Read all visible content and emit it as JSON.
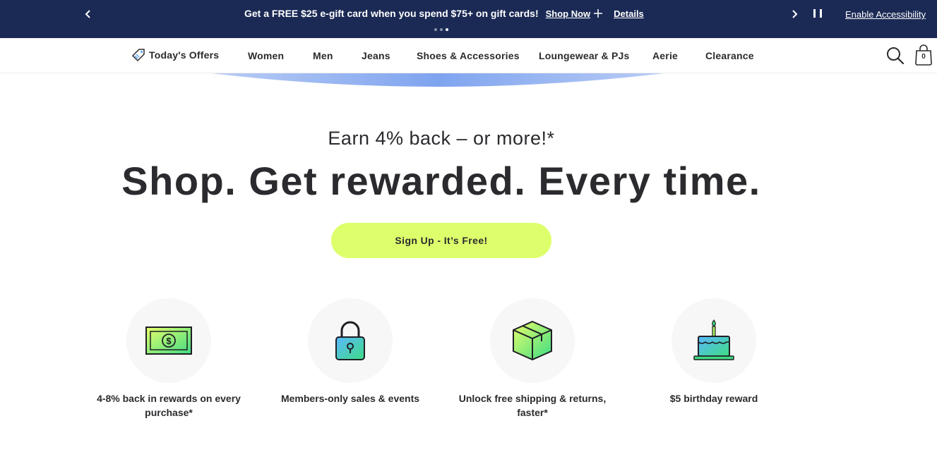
{
  "promo": {
    "message": "Get a FREE $25 e-gift card when you spend $75+ on gift cards!",
    "shop_link": "Shop Now",
    "details_link": "Details",
    "accessibility_link": "Enable Accessibility",
    "background": "#1b2a55"
  },
  "nav": {
    "offers": "Today's Offers",
    "items": [
      "Women",
      "Men",
      "Jeans",
      "Shoes & Accessories",
      "Loungewear & PJs",
      "Aerie",
      "Clearance"
    ],
    "bag_count": "0"
  },
  "hero": {
    "kicker": "Earn 4% back – or more!*",
    "headline": "Shop. Get rewarded. Every time.",
    "cta": "Sign Up - It’s Free!",
    "cta_color": "#ddff6b"
  },
  "benefits": [
    {
      "icon": "cash-icon",
      "label": "4-8% back in rewards on every purchase*"
    },
    {
      "icon": "lock-icon",
      "label": "Members-only sales & events"
    },
    {
      "icon": "box-icon",
      "label": "Unlock free shipping & returns, faster*"
    },
    {
      "icon": "birthday-cake-icon",
      "label": "$5 birthday reward"
    }
  ]
}
